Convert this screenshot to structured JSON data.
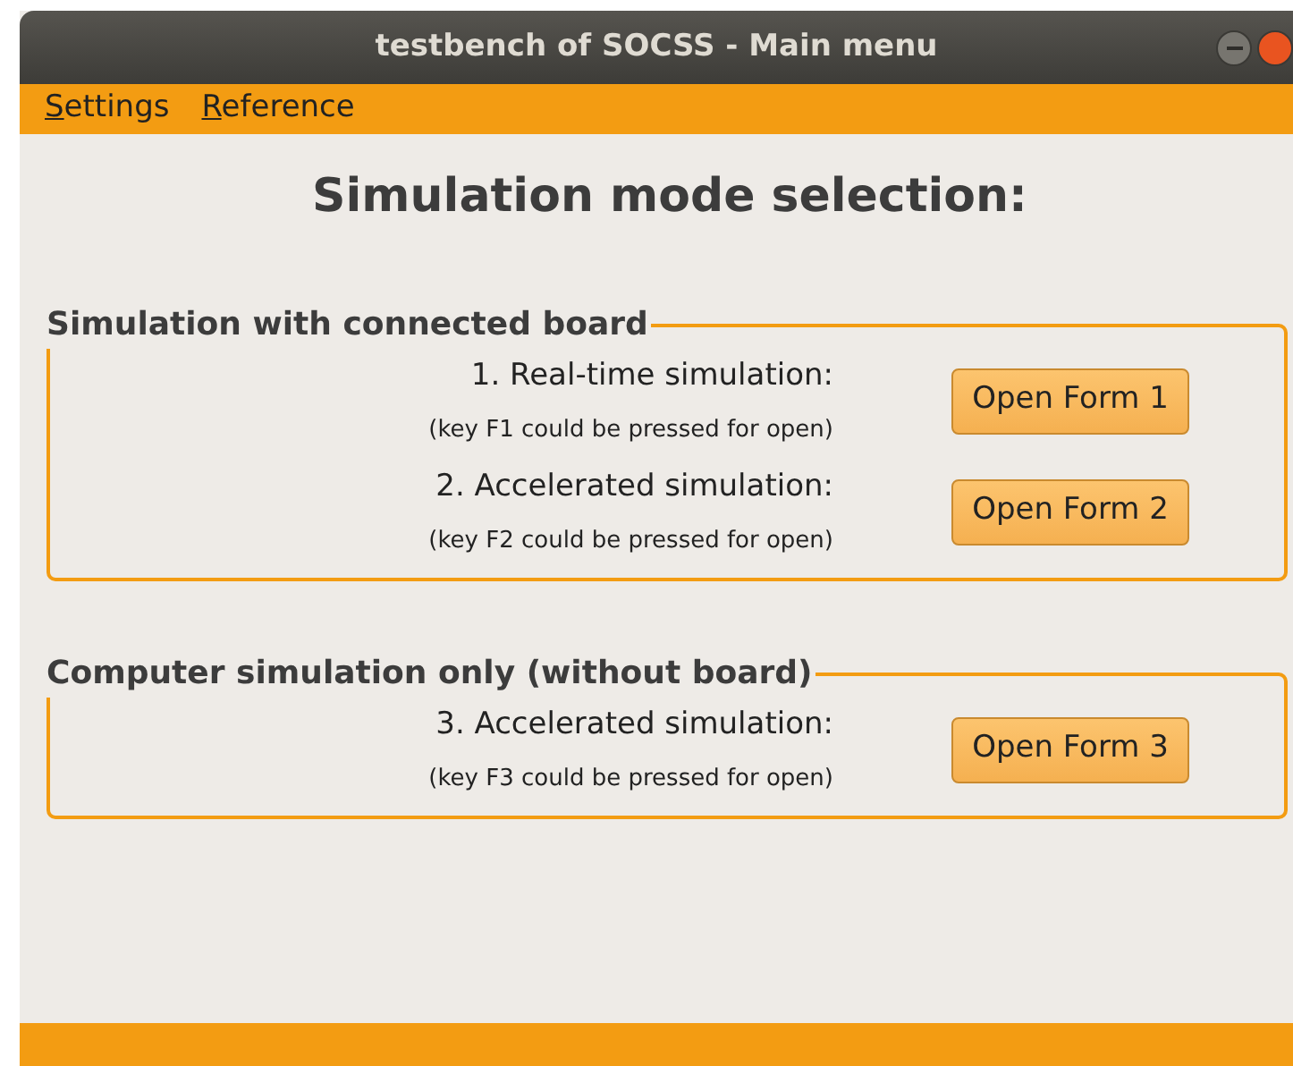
{
  "window": {
    "title": "testbench of SOCSS - Main menu"
  },
  "menu": [
    "Settings",
    "Reference"
  ],
  "heading": "Simulation mode selection:",
  "groups": [
    {
      "title": "Simulation with connected board",
      "rows": [
        {
          "label": "1. Real-time simulation:",
          "hint": "(key F1 could be pressed for open)",
          "button": "Open Form 1"
        },
        {
          "label": "2. Accelerated simulation:",
          "hint": "(key F2 could be pressed for open)",
          "button": "Open Form 2"
        }
      ]
    },
    {
      "title": "Computer simulation only (without board)",
      "rows": [
        {
          "label": "3. Accelerated simulation:",
          "hint": "(key F3 could be pressed for open)",
          "button": "Open Form 3"
        }
      ]
    }
  ]
}
